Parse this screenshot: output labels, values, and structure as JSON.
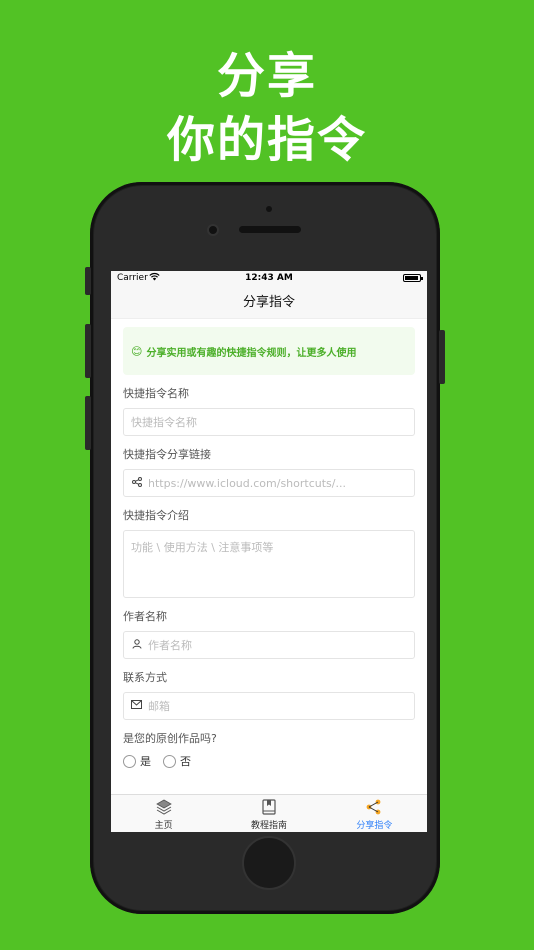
{
  "headline": {
    "line1": "分享",
    "line2": "你的指令"
  },
  "status_bar": {
    "carrier": "Carrier",
    "time": "12:43 AM"
  },
  "nav": {
    "title": "分享指令"
  },
  "notice": {
    "emoji": "😊",
    "text": "分享实用或有趣的快捷指令规则，让更多人使用"
  },
  "form": {
    "name": {
      "label": "快捷指令名称",
      "placeholder": "快捷指令名称"
    },
    "link": {
      "label": "快捷指令分享链接",
      "placeholder": "https://www.icloud.com/shortcuts/...",
      "icon": "share-icon"
    },
    "intro": {
      "label": "快捷指令介绍",
      "placeholder": "功能 \\ 使用方法 \\ 注意事项等"
    },
    "author": {
      "label": "作者名称",
      "placeholder": "作者名称",
      "icon": "user-icon"
    },
    "contact": {
      "label": "联系方式",
      "placeholder": "邮箱",
      "icon": "mail-icon"
    },
    "original": {
      "label": "是您的原创作品吗?",
      "options": [
        "是",
        "否"
      ]
    }
  },
  "tabs": [
    {
      "label": "主页",
      "icon": "layers-icon"
    },
    {
      "label": "教程指南",
      "icon": "book-icon"
    },
    {
      "label": "分享指令",
      "icon": "share-icon",
      "active": true
    }
  ],
  "colors": {
    "background": "#52c225",
    "accent": "#2d7ff9",
    "notice_text": "#4caf2a"
  }
}
